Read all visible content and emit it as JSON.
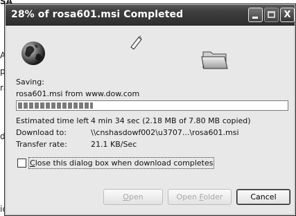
{
  "background": {
    "fragments": [
      "SA",
      "A",
      "pa",
      "ra",
      "d",
      "ic"
    ]
  },
  "window": {
    "title": "28% of rosa601.msi Completed",
    "controls": {
      "minimize": "minimize",
      "maximize": "maximize",
      "close": "X"
    }
  },
  "status": {
    "saving_label": "Saving:",
    "source_line": "rosa601.msi from www.dow.com",
    "progress_fraction": 0.28
  },
  "details": {
    "time_left_label": "Estimated time left",
    "time_left_value": "4 min 34 sec (2.18 MB of 7.80 MB copied)",
    "download_to_label": "Download to:",
    "download_to_value": "\\\\cnshasdowf002\\u3707...\\rosa601.msi",
    "transfer_rate_label": "Transfer rate:",
    "transfer_rate_value": "21.1 KB/Sec"
  },
  "options": {
    "close_when_done_prefix": "C",
    "close_when_done_rest": "lose this dialog box when download completes",
    "close_when_done_checked": false
  },
  "buttons": {
    "open_u": "O",
    "open_rest": "pen",
    "open_folder_pre": "Open ",
    "open_folder_u": "F",
    "open_folder_rest": "older",
    "cancel": "Cancel"
  },
  "icons": {
    "globe": "globe-icon",
    "document": "flying-document-icon",
    "folder": "folder-icon"
  }
}
